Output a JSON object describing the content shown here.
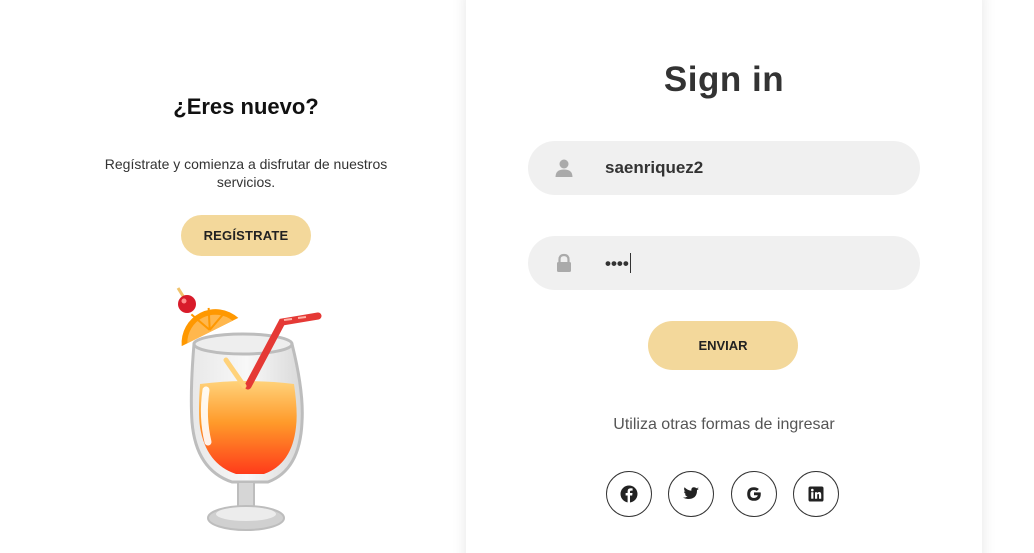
{
  "left": {
    "title": "¿Eres nuevo?",
    "description": "Regístrate y comienza a disfrutar de nuestros servicios.",
    "register_label": "REGÍSTRATE",
    "illustration": "cocktail-glass-illustration"
  },
  "signin": {
    "title": "Sign in",
    "username_value": "saenriquez2",
    "username_icon": "user-icon",
    "password_value": "••••",
    "password_icon": "lock-icon",
    "submit_label": "ENVIAR",
    "alt_text": "Utiliza otras formas de ingresar",
    "social": [
      {
        "name": "facebook",
        "icon": "facebook-icon"
      },
      {
        "name": "twitter",
        "icon": "twitter-icon"
      },
      {
        "name": "google",
        "icon": "google-icon"
      },
      {
        "name": "linkedin",
        "icon": "linkedin-icon"
      }
    ]
  },
  "colors": {
    "accent": "#f3d89b",
    "field_bg": "#f0f0f0",
    "text_dark": "#333333"
  }
}
